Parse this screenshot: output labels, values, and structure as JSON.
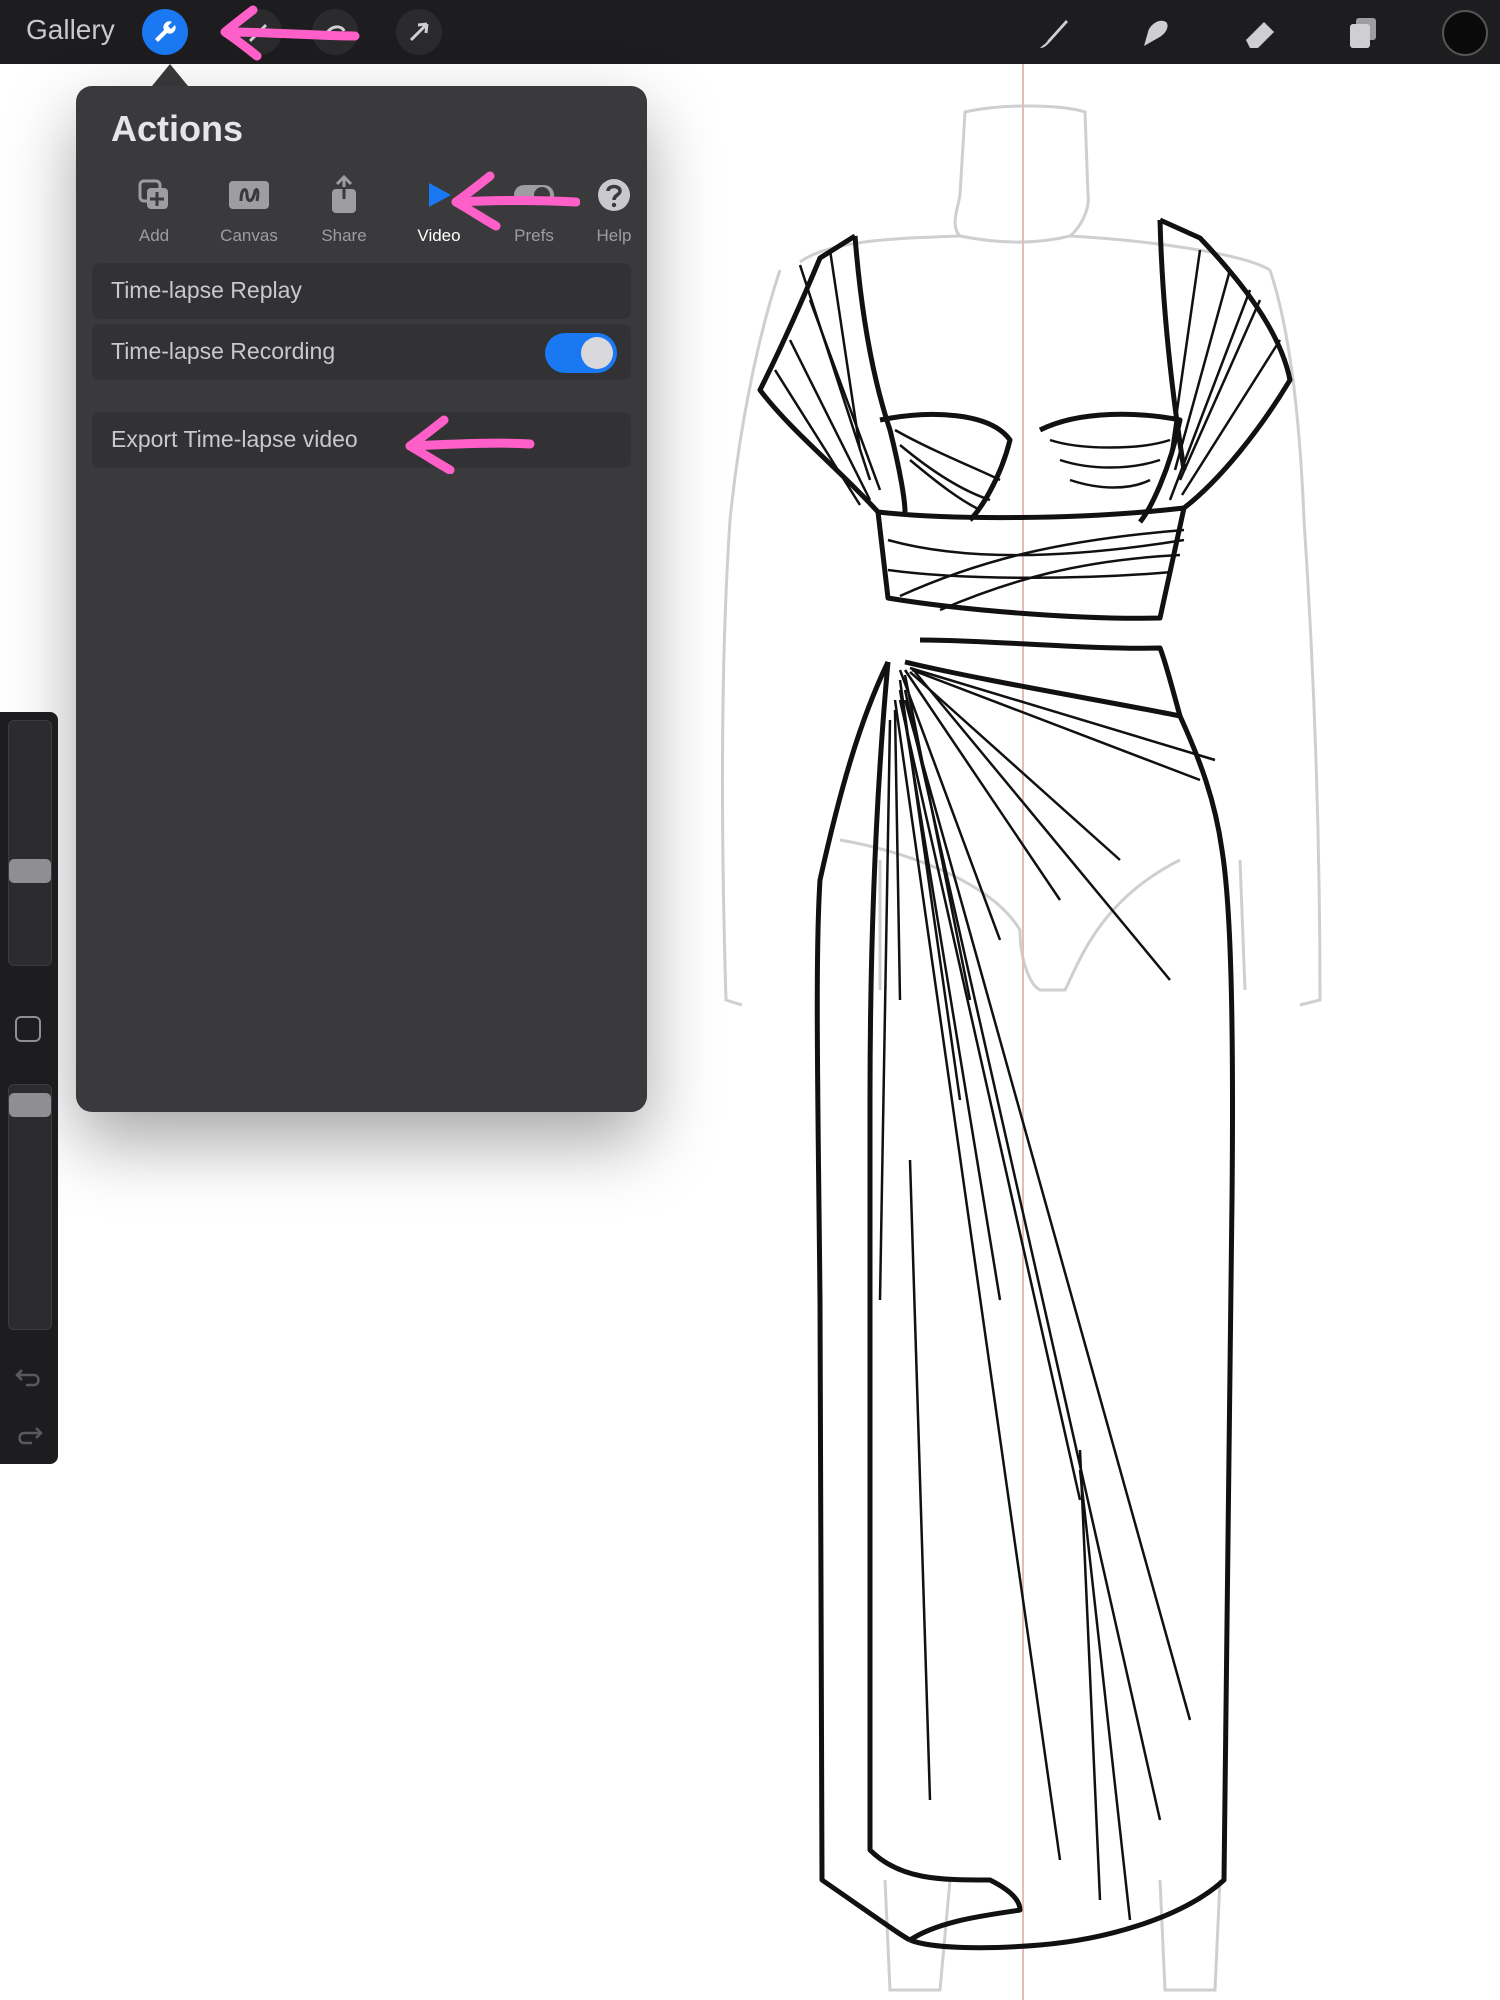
{
  "topbar": {
    "gallery_label": "Gallery",
    "left_tools": [
      "wrench-icon",
      "magic-wand-icon",
      "selection-icon",
      "transform-arrow-icon"
    ],
    "right_tools": [
      "brush-icon",
      "smudge-icon",
      "eraser-icon",
      "layers-icon",
      "color-icon"
    ]
  },
  "actions": {
    "title": "Actions",
    "tabs": [
      {
        "label": "Add",
        "icon": "add-icon"
      },
      {
        "label": "Canvas",
        "icon": "canvas-icon"
      },
      {
        "label": "Share",
        "icon": "share-icon"
      },
      {
        "label": "Video",
        "icon": "play-icon",
        "active": true
      },
      {
        "label": "Prefs",
        "icon": "prefs-toggle-icon"
      },
      {
        "label": "Help",
        "icon": "help-icon"
      }
    ],
    "items": {
      "replay": "Time-lapse Replay",
      "recording": "Time-lapse Recording",
      "recording_on": true,
      "export": "Export Time-lapse video"
    }
  },
  "colors": {
    "accent": "#1a78f2",
    "annotation": "#ff5fc8",
    "panel": "#3a3a3c"
  }
}
